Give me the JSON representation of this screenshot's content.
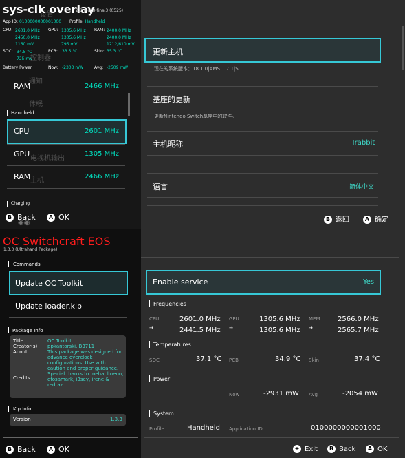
{
  "q1": {
    "title": "sys-clk overlay",
    "ghost_title": "设置",
    "version": "2.0.0-oc8-final3 (0525)",
    "app_id_label": "App ID:",
    "app_id": "0100000000001000",
    "profile_label": "Profile:",
    "profile": "Handheld",
    "cpu_label": "CPU:",
    "cpu_vals": [
      "2601.0 MHz",
      "2450.0 MHz",
      "1160 mV"
    ],
    "gpu_label": "GPU:",
    "gpu_vals": [
      "1305.6 MHz",
      "1305.6 MHz",
      "795 mV"
    ],
    "ram_label": "RAM:",
    "ram_vals": [
      "2400.0 MHz",
      "2400.0 MHz",
      "1212/610 mV"
    ],
    "soc_label": "SOC:",
    "soc_vals": [
      "34.5 °C",
      "725 mV"
    ],
    "pcb_label": "PCB:",
    "pcb_val": "33.5 °C",
    "skin_label": "Skin:",
    "skin_val": "35.3 °C",
    "battery_label": "Battery Power",
    "now_label": "Now:",
    "now_val": "-2303 mW",
    "avg_label": "Avg:",
    "avg_val": "-2509 mW",
    "ghost_items": [
      "通知",
      "休眠",
      "电视机输出",
      "主机"
    ],
    "ghost_top": "控制器",
    "ram_row": {
      "label": "RAM",
      "value": "2466 MHz"
    },
    "handheld_header": "Handheld",
    "rows": [
      {
        "label": "CPU",
        "value": "2601 MHz"
      },
      {
        "label": "GPU",
        "value": "1305 MHz"
      },
      {
        "label": "RAM",
        "value": "2466 MHz"
      }
    ],
    "charging_header": "Charging",
    "back": "Back",
    "ok": "OK",
    "btn_b": "B",
    "btn_a": "A"
  },
  "q2": {
    "items": [
      {
        "title": "更新主机",
        "sub": "现在的系统版本：18.1.0|AMS 1.7.1|S",
        "value": ""
      },
      {
        "title": "基座的更新",
        "sub": "更新Nintendo Switch基座中的软件。",
        "value": ""
      },
      {
        "title": "主机昵称",
        "sub": "",
        "value": "Trabbit"
      },
      {
        "title": "语言",
        "sub": "",
        "value": "简体中文"
      }
    ],
    "back": "返回",
    "ok": "确定",
    "btn_b": "B",
    "btn_a": "A"
  },
  "q3": {
    "title": "OC Switchcraft EOS",
    "version": "1.3.3   (Ultrahand Package)",
    "commands_header": "Commands",
    "items": [
      "Update OC Toolkit",
      "Update loader.kip"
    ],
    "package_header": "Package Info",
    "info": [
      {
        "key": "Title",
        "value": "OC Toolkit"
      },
      {
        "key": "Creator(s)",
        "value": "ppkantorski, B3711"
      },
      {
        "key": "About",
        "value": "This package was designed for advance overclock configurations. Use with caution and proper guidance."
      },
      {
        "key": "Credits",
        "value": "Special thanks to meha, lineon, efosamark, i3sey, irene & redraz."
      }
    ],
    "kip_header": "Kip Info",
    "version_label": "Version",
    "version_value": "1.3.3",
    "back": "Back",
    "ok": "OK",
    "btn_b": "B",
    "btn_a": "A"
  },
  "q4": {
    "enable_label": "Enable service",
    "enable_value": "Yes",
    "freq_header": "Frequencies",
    "cpu_label": "CPU",
    "cpu_vals": [
      "2601.0 MHz",
      "2441.5 MHz"
    ],
    "gpu_label": "GPU",
    "gpu_vals": [
      "1305.6 MHz",
      "1305.6 MHz"
    ],
    "mem_label": "MEM",
    "mem_vals": [
      "2566.0 MHz",
      "2565.7 MHz"
    ],
    "arrow": "→",
    "temp_header": "Temperatures",
    "soc_label": "SOC",
    "soc_val": "37.1 °C",
    "pcb_label": "PCB",
    "pcb_val": "34.9 °C",
    "skin_label": "Skin",
    "skin_val": "37.4 °C",
    "power_header": "Power",
    "now_label": "Now",
    "now_val": "-2931 mW",
    "avg_label": "Avg",
    "avg_val": "-2054 mW",
    "system_header": "System",
    "profile_label": "Profile",
    "profile_val": "Handheld",
    "appid_label": "Application ID",
    "appid_val": "0100000000001000",
    "exit": "Exit",
    "back": "Back",
    "ok": "OK",
    "btn_plus": "+",
    "btn_b": "B",
    "btn_a": "A"
  }
}
